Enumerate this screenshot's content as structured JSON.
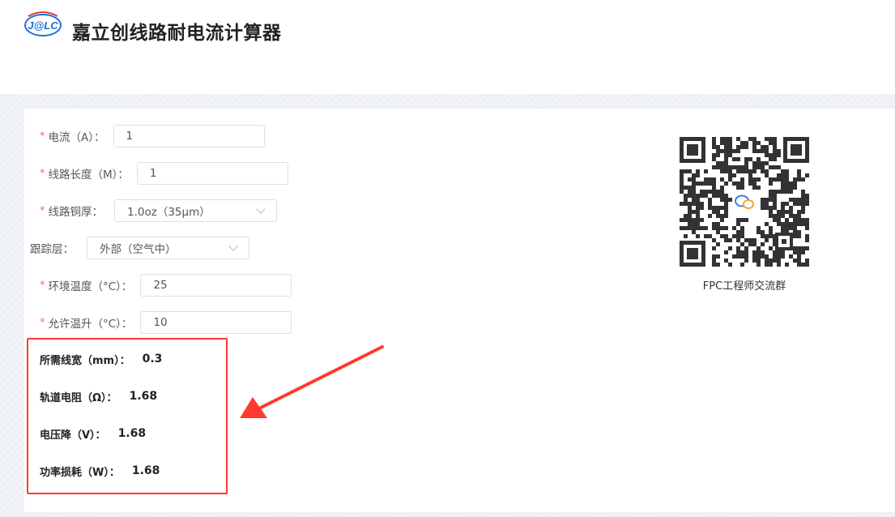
{
  "header": {
    "logo_text": "J@LC",
    "title": "嘉立创线路耐电流计算器"
  },
  "form": {
    "required_mark": "*",
    "current": {
      "label": "电流（A）：",
      "value": "1"
    },
    "length": {
      "label": "线路长度（M）：",
      "value": "1"
    },
    "copper": {
      "label": "线路铜厚：",
      "value": "1.0oz（35μm）"
    },
    "layer": {
      "label": "跟踪层：",
      "value": "外部（空气中）"
    },
    "ambient": {
      "label": "环境温度（°C）：",
      "value": "25"
    },
    "rise": {
      "label": "允许温升（°C）：",
      "value": "10"
    }
  },
  "results": {
    "width": {
      "label": "所需线宽（mm）：",
      "value": "0.3"
    },
    "resistance": {
      "label": "轨道电阻（Ω）：",
      "value": "1.68"
    },
    "voltage": {
      "label": "电压降（V）：",
      "value": "1.68"
    },
    "power": {
      "label": "功率损耗（W）：",
      "value": "1.68"
    }
  },
  "qr": {
    "icon": "wechat-icon",
    "caption": "FPC工程师交流群"
  },
  "colors": {
    "required": "#f56c6c",
    "highlight": "#ff3b30",
    "logo_blue": "#1e6fd9"
  }
}
